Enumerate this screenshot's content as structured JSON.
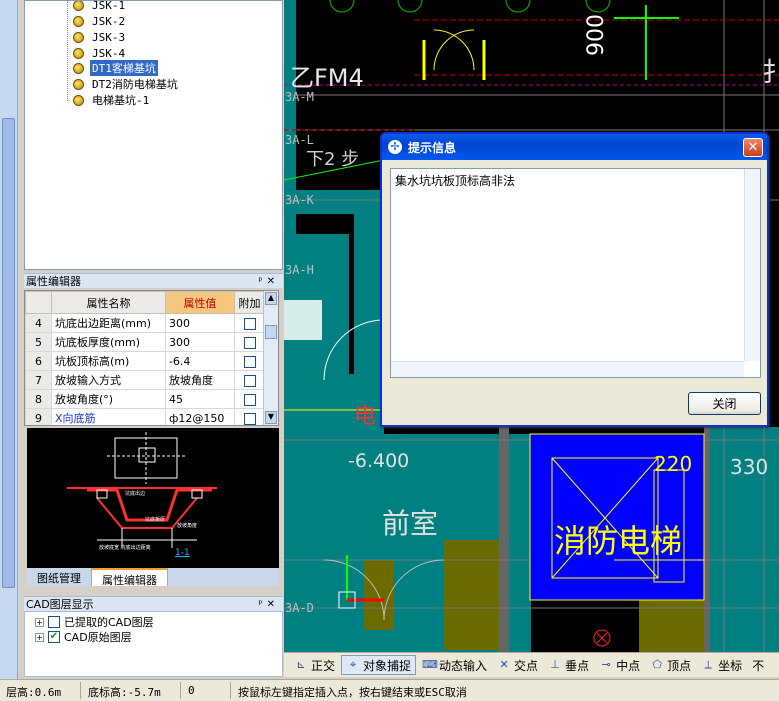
{
  "tree": {
    "items": [
      {
        "label": "JSK-1",
        "selected": false
      },
      {
        "label": "JSK-2",
        "selected": false
      },
      {
        "label": "JSK-3",
        "selected": false
      },
      {
        "label": "JSK-4",
        "selected": false
      },
      {
        "label": "DT1客梯基坑",
        "selected": true
      },
      {
        "label": "DT2消防电梯基坑",
        "selected": false
      },
      {
        "label": "电梯基坑-1",
        "selected": false
      }
    ]
  },
  "property_editor": {
    "title": "属性编辑器",
    "columns": [
      "属性名称",
      "属性值",
      "附加"
    ],
    "rows": [
      {
        "num": "4",
        "name": "坑底出边距离(mm)",
        "value": "300"
      },
      {
        "num": "5",
        "name": "坑底板厚度(mm)",
        "value": "300"
      },
      {
        "num": "6",
        "name": "坑板顶标高(m)",
        "value": "-6.4"
      },
      {
        "num": "7",
        "name": "放坡输入方式",
        "value": "放坡角度"
      },
      {
        "num": "8",
        "name": "放坡角度(°)",
        "value": "45"
      },
      {
        "num": "9",
        "name": "X向底筋",
        "value": "ф12@150"
      }
    ]
  },
  "preview": {
    "section_label": "1-1",
    "annotations": [
      "坑底出边",
      "坑底板厚",
      "放坡角度",
      "放坡底宽 坑底出边距离"
    ]
  },
  "tabs": [
    "图纸管理",
    "属性编辑器"
  ],
  "cad_layers": {
    "title": "CAD图层显示",
    "items": [
      {
        "label": "已提取的CAD图层",
        "checked": false
      },
      {
        "label": "CAD原始图层",
        "checked": true
      }
    ]
  },
  "cad_canvas": {
    "texts": [
      "乙FM4",
      "900",
      "下2 步",
      "3A-M",
      "3A-L",
      "3A-K",
      "3A-H",
      "3A-D",
      "电",
      "-6.400",
      "前室",
      "220",
      "330",
      "消防电梯",
      "扌"
    ]
  },
  "dialog": {
    "title": "提示信息",
    "message": "集水坑坑板顶标高非法",
    "close_label": "关闭"
  },
  "snap_toolbar": {
    "items": [
      {
        "label": "正交",
        "icon": "ortho-icon",
        "on": false
      },
      {
        "label": "对象捕捉",
        "icon": "object-snap-icon",
        "on": true
      },
      {
        "label": "动态输入",
        "icon": "dynamic-input-icon",
        "on": false
      },
      {
        "label": "交点",
        "icon": "intersection-icon",
        "on": false
      },
      {
        "label": "垂点",
        "icon": "perpendicular-icon",
        "on": false
      },
      {
        "label": "中点",
        "icon": "midpoint-icon",
        "on": false
      },
      {
        "label": "顶点",
        "icon": "vertex-icon",
        "on": false
      },
      {
        "label": "坐标",
        "icon": "coordinate-icon",
        "on": false
      },
      {
        "label": "不",
        "icon": "",
        "on": false
      }
    ]
  },
  "status": {
    "floor_height": "层高:0.6m",
    "base_elevation": "底标高:-5.7m",
    "value": "0",
    "hint": "按鼠标左键指定插入点，按右键结束或ESC取消"
  },
  "colors": {
    "cad_bg": "#000000",
    "teal_fill": "#008080",
    "blue_fill": "#0000ff",
    "dialog_title": "#0a5be8"
  }
}
